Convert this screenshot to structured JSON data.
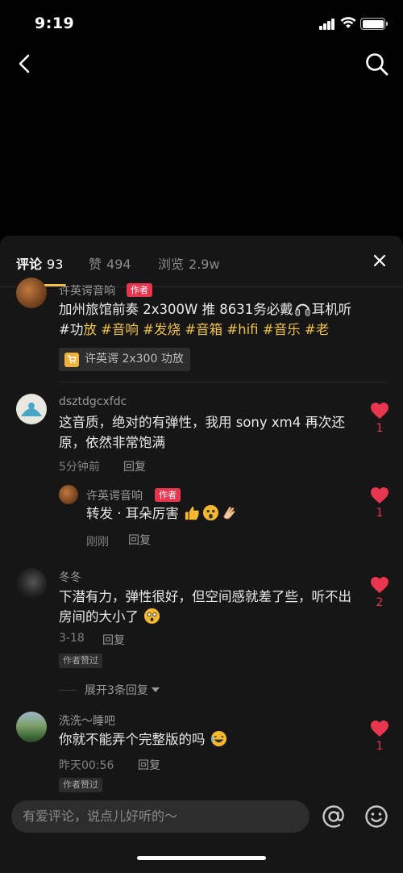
{
  "status_bar": {
    "time": "9:19"
  },
  "tabs": {
    "comments": {
      "label": "评论",
      "count": "93"
    },
    "likes": {
      "label": "赞",
      "count": "494"
    },
    "views": {
      "label": "浏览",
      "count": "2.9w"
    }
  },
  "comments": [
    {
      "username": "许英谔音响",
      "author_tag": "作者",
      "text_parts": [
        {
          "t": "加州旅馆前奏 2x300W 推 8631务必戴",
          "hl": false
        },
        {
          "t": "耳机听#功",
          "hl": false
        },
        {
          "t": "放",
          "hl": true
        },
        {
          "t": " #音",
          "hl": true
        },
        {
          "t": "响",
          "hl": true
        },
        {
          "t": " #发",
          "hl": true
        },
        {
          "t": "烧",
          "hl": true
        },
        {
          "t": " #音",
          "hl": true
        },
        {
          "t": "箱",
          "hl": true
        },
        {
          "t": " #hifi",
          "hl": true
        },
        {
          "t": " #音",
          "hl": true
        },
        {
          "t": "乐",
          "hl": true
        },
        {
          "t": " #老",
          "hl": true
        }
      ],
      "product_tag": "许英谔 2x300 功放"
    },
    {
      "username": "dsztdgcxfdc",
      "text": "这音质，绝对的有弹性，我用 sony xm4 再次还原，依然非常饱满",
      "time": "5分钟前",
      "reply_label": "回复",
      "likes": "1"
    },
    {
      "username": "许英谔音响",
      "author_tag": "作者",
      "text": "转发 · 耳朵厉害",
      "time": "刚刚",
      "reply_label": "回复",
      "likes": "1"
    },
    {
      "username": "冬冬",
      "text": "下潜有力，弹性很好，但空间感就差了些，听不出房间的大小了",
      "time": "3-18",
      "reply_label": "回复",
      "approved": "作者赞过",
      "likes": "2",
      "expand": "展开3条回复"
    },
    {
      "username": "洗洗～睡吧",
      "text": "你就不能弄个完整版的吗",
      "time": "昨天00:56",
      "reply_label": "回复",
      "approved": "作者赞过",
      "likes": "1"
    }
  ],
  "input": {
    "placeholder": "有爱评论，说点儿好听的～"
  },
  "colors": {
    "accent": "#f0c24b",
    "like": "#e8364f",
    "sheet_bg": "#161616"
  }
}
